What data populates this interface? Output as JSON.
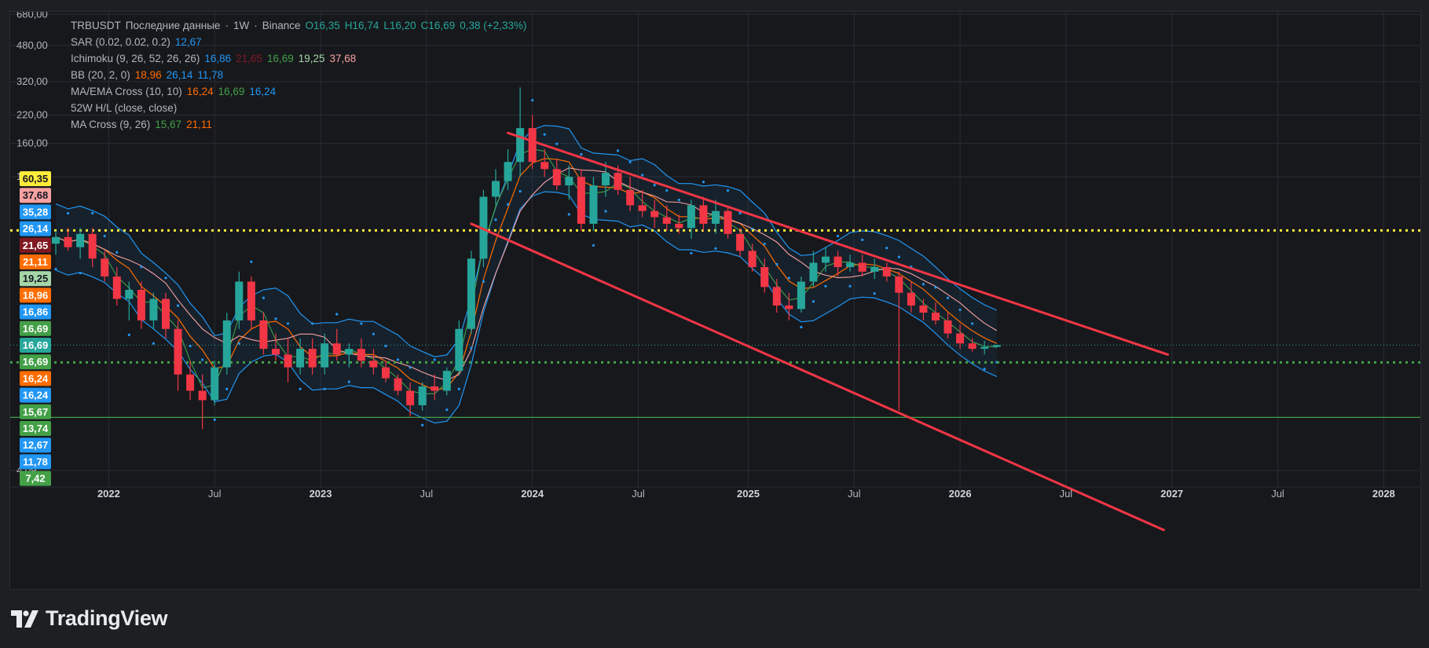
{
  "legend": {
    "symbol": "TRBUSDT",
    "data_label": "Последние данные",
    "interval": "1W",
    "exchange": "Binance",
    "ohlc": {
      "o": "O16,35",
      "h": "H16,74",
      "l": "L16,20",
      "c": "C16,69",
      "change": "0,38 (+2,33%)"
    },
    "indicators": [
      {
        "name": "SAR (0.02, 0.02, 0.2)",
        "values": [
          {
            "v": "12,67",
            "color": "#2196f3"
          }
        ]
      },
      {
        "name": "Ichimoku (9, 26, 52, 26, 26)",
        "values": [
          {
            "v": "16,86",
            "color": "#2196f3"
          },
          {
            "v": "21,65",
            "color": "#801922"
          },
          {
            "v": "16,69",
            "color": "#43a047"
          },
          {
            "v": "19,25",
            "color": "#a5d6a7"
          },
          {
            "v": "37,68",
            "color": "#f7a1a1"
          }
        ]
      },
      {
        "name": "BB (20, 2, 0)",
        "values": [
          {
            "v": "18,96",
            "color": "#ff6d00"
          },
          {
            "v": "26,14",
            "color": "#2196f3"
          },
          {
            "v": "11,78",
            "color": "#2196f3"
          }
        ]
      },
      {
        "name": "MA/EMA Cross (10, 10)",
        "values": [
          {
            "v": "16,24",
            "color": "#ff6d00"
          },
          {
            "v": "16,69",
            "color": "#43a047"
          },
          {
            "v": "16,24",
            "color": "#2196f3"
          }
        ]
      },
      {
        "name": "52W H/L (close, close)",
        "values": []
      },
      {
        "name": "MA Cross (9, 26)",
        "values": [
          {
            "v": "15,67",
            "color": "#43a047"
          },
          {
            "v": "21,11",
            "color": "#ff6d00"
          }
        ]
      }
    ]
  },
  "watermark": {
    "text": "TradingView"
  },
  "chart_data": {
    "type": "candlestick",
    "y_scale": "log",
    "y_ticks": [
      "680,00",
      "480,00",
      "320,00",
      "220,00",
      "160,00",
      "110,00",
      "4,09"
    ],
    "y_tick_values": [
      680,
      480,
      320,
      220,
      160,
      110,
      4.09
    ],
    "x_ticks": [
      {
        "label": "2022",
        "date": "2022-01-03"
      },
      {
        "label": "Jul",
        "date": "2022-07-04"
      },
      {
        "label": "2023",
        "date": "2023-01-02"
      },
      {
        "label": "Jul",
        "date": "2023-07-03"
      },
      {
        "label": "2024",
        "date": "2024-01-01"
      },
      {
        "label": "Jul",
        "date": "2024-07-01"
      },
      {
        "label": "2025",
        "date": "2025-01-06"
      },
      {
        "label": "Jul",
        "date": "2025-07-07"
      },
      {
        "label": "2026",
        "date": "2026-01-05"
      },
      {
        "label": "Jul",
        "date": "2026-07-06"
      },
      {
        "label": "2027",
        "date": "2027-01-04"
      },
      {
        "label": "Jul",
        "date": "2027-07-05"
      },
      {
        "label": "2028",
        "date": "2028-01-03"
      }
    ],
    "x_range": [
      "2021-10-04",
      "2028-03-06"
    ],
    "y_range": [
      3.4,
      700
    ],
    "price_labels": [
      {
        "v": "60,35",
        "bg": "#ffeb3b",
        "fg": "#131722"
      },
      {
        "v": "37,68",
        "bg": "#f7a1a1",
        "fg": "#131722"
      },
      {
        "v": "35,28",
        "bg": "#2196f3",
        "fg": "#ffffff"
      },
      {
        "v": "26,14",
        "bg": "#2196f3",
        "fg": "#ffffff"
      },
      {
        "v": "21,65",
        "bg": "#801922",
        "fg": "#ffffff"
      },
      {
        "v": "21,11",
        "bg": "#ff6d00",
        "fg": "#ffffff"
      },
      {
        "v": "19,25",
        "bg": "#a5d6a7",
        "fg": "#131722"
      },
      {
        "v": "18,96",
        "bg": "#ff6d00",
        "fg": "#ffffff"
      },
      {
        "v": "16,86",
        "bg": "#2196f3",
        "fg": "#ffffff"
      },
      {
        "v": "16,69",
        "bg": "#43a047",
        "fg": "#ffffff"
      },
      {
        "v": "16,69",
        "bg": "#26a69a",
        "fg": "#ffffff"
      },
      {
        "v": "16,69",
        "bg": "#43a047",
        "fg": "#ffffff"
      },
      {
        "v": "16,24",
        "bg": "#ff6d00",
        "fg": "#ffffff"
      },
      {
        "v": "16,24",
        "bg": "#2196f3",
        "fg": "#ffffff"
      },
      {
        "v": "15,67",
        "bg": "#43a047",
        "fg": "#ffffff"
      },
      {
        "v": "13,74",
        "bg": "#43a047",
        "fg": "#ffffff"
      },
      {
        "v": "12,67",
        "bg": "#2196f3",
        "fg": "#ffffff"
      },
      {
        "v": "11,78",
        "bg": "#2196f3",
        "fg": "#ffffff"
      },
      {
        "v": "7,42",
        "bg": "#43a047",
        "fg": "#ffffff"
      }
    ],
    "horizontal_levels": [
      {
        "value": 60.35,
        "style": "dotted",
        "color": "#ffeb3b"
      },
      {
        "value": 13.74,
        "style": "dotted",
        "color": "#43a047"
      },
      {
        "value": 7.42,
        "style": "solid",
        "color": "#43a047"
      },
      {
        "value": 16.69,
        "style": "dotted",
        "color": "#26a69a"
      }
    ],
    "trend_lines": [
      {
        "from": [
          "2023-11-20",
          180
        ],
        "to": [
          "2026-12-28",
          15
        ],
        "color": "#f23645"
      },
      {
        "from": [
          "2023-09-18",
          65
        ],
        "to": [
          "2026-12-21",
          2.1
        ],
        "color": "#f23645"
      }
    ],
    "candles": [
      {
        "date": "2021-10-04",
        "o": 52,
        "h": 60,
        "l": 46,
        "c": 56
      },
      {
        "date": "2021-10-25",
        "o": 56,
        "h": 62,
        "l": 48,
        "c": 50
      },
      {
        "date": "2021-11-15",
        "o": 50,
        "h": 62,
        "l": 44,
        "c": 58
      },
      {
        "date": "2021-12-06",
        "o": 58,
        "h": 62,
        "l": 40,
        "c": 44
      },
      {
        "date": "2021-12-27",
        "o": 44,
        "h": 48,
        "l": 34,
        "c": 36
      },
      {
        "date": "2022-01-17",
        "o": 36,
        "h": 40,
        "l": 26,
        "c": 28
      },
      {
        "date": "2022-02-07",
        "o": 28,
        "h": 34,
        "l": 22,
        "c": 31
      },
      {
        "date": "2022-02-28",
        "o": 31,
        "h": 34,
        "l": 20,
        "c": 22
      },
      {
        "date": "2022-03-21",
        "o": 22,
        "h": 30,
        "l": 20,
        "c": 28
      },
      {
        "date": "2022-04-11",
        "o": 28,
        "h": 30,
        "l": 18,
        "c": 20
      },
      {
        "date": "2022-05-02",
        "o": 20,
        "h": 22,
        "l": 10,
        "c": 12
      },
      {
        "date": "2022-05-23",
        "o": 12,
        "h": 14,
        "l": 9,
        "c": 10
      },
      {
        "date": "2022-06-13",
        "o": 10,
        "h": 12,
        "l": 6.5,
        "c": 9
      },
      {
        "date": "2022-07-04",
        "o": 9,
        "h": 14,
        "l": 8.5,
        "c": 13
      },
      {
        "date": "2022-07-25",
        "o": 13,
        "h": 24,
        "l": 12,
        "c": 22
      },
      {
        "date": "2022-08-15",
        "o": 22,
        "h": 38,
        "l": 20,
        "c": 34
      },
      {
        "date": "2022-09-05",
        "o": 34,
        "h": 36,
        "l": 20,
        "c": 22
      },
      {
        "date": "2022-09-26",
        "o": 22,
        "h": 24,
        "l": 15,
        "c": 16
      },
      {
        "date": "2022-10-17",
        "o": 16,
        "h": 19,
        "l": 14,
        "c": 15
      },
      {
        "date": "2022-11-07",
        "o": 15,
        "h": 18,
        "l": 11,
        "c": 13
      },
      {
        "date": "2022-11-28",
        "o": 13,
        "h": 18,
        "l": 12,
        "c": 16
      },
      {
        "date": "2022-12-19",
        "o": 16,
        "h": 18,
        "l": 12,
        "c": 13
      },
      {
        "date": "2023-01-09",
        "o": 13,
        "h": 19,
        "l": 12,
        "c": 17
      },
      {
        "date": "2023-01-30",
        "o": 17,
        "h": 20,
        "l": 14,
        "c": 15
      },
      {
        "date": "2023-02-20",
        "o": 15,
        "h": 17,
        "l": 13,
        "c": 16
      },
      {
        "date": "2023-03-13",
        "o": 16,
        "h": 18,
        "l": 13,
        "c": 14
      },
      {
        "date": "2023-04-03",
        "o": 14,
        "h": 16,
        "l": 12,
        "c": 13
      },
      {
        "date": "2023-04-24",
        "o": 13,
        "h": 14,
        "l": 11,
        "c": 11.5
      },
      {
        "date": "2023-05-15",
        "o": 11.5,
        "h": 12,
        "l": 9.5,
        "c": 10
      },
      {
        "date": "2023-06-05",
        "o": 10,
        "h": 11,
        "l": 7.5,
        "c": 8.5
      },
      {
        "date": "2023-06-26",
        "o": 8.5,
        "h": 11,
        "l": 8,
        "c": 10.5
      },
      {
        "date": "2023-07-17",
        "o": 10.5,
        "h": 12,
        "l": 9,
        "c": 10
      },
      {
        "date": "2023-08-07",
        "o": 10,
        "h": 13,
        "l": 9.5,
        "c": 12.5
      },
      {
        "date": "2023-08-28",
        "o": 12.5,
        "h": 22,
        "l": 12,
        "c": 20
      },
      {
        "date": "2023-09-18",
        "o": 20,
        "h": 48,
        "l": 19,
        "c": 44
      },
      {
        "date": "2023-10-09",
        "o": 44,
        "h": 95,
        "l": 40,
        "c": 88
      },
      {
        "date": "2023-10-30",
        "o": 88,
        "h": 120,
        "l": 80,
        "c": 105
      },
      {
        "date": "2023-11-20",
        "o": 105,
        "h": 150,
        "l": 95,
        "c": 130
      },
      {
        "date": "2023-12-11",
        "o": 130,
        "h": 300,
        "l": 110,
        "c": 190
      },
      {
        "date": "2024-01-01",
        "o": 190,
        "h": 220,
        "l": 120,
        "c": 130
      },
      {
        "date": "2024-01-22",
        "o": 130,
        "h": 150,
        "l": 110,
        "c": 120
      },
      {
        "date": "2024-02-12",
        "o": 120,
        "h": 135,
        "l": 95,
        "c": 100
      },
      {
        "date": "2024-03-04",
        "o": 100,
        "h": 125,
        "l": 85,
        "c": 110
      },
      {
        "date": "2024-03-25",
        "o": 110,
        "h": 120,
        "l": 60,
        "c": 65
      },
      {
        "date": "2024-04-15",
        "o": 65,
        "h": 110,
        "l": 60,
        "c": 100
      },
      {
        "date": "2024-05-06",
        "o": 100,
        "h": 130,
        "l": 88,
        "c": 115
      },
      {
        "date": "2024-05-27",
        "o": 115,
        "h": 125,
        "l": 90,
        "c": 95
      },
      {
        "date": "2024-06-17",
        "o": 95,
        "h": 110,
        "l": 75,
        "c": 80
      },
      {
        "date": "2024-07-08",
        "o": 80,
        "h": 95,
        "l": 70,
        "c": 75
      },
      {
        "date": "2024-07-29",
        "o": 75,
        "h": 85,
        "l": 62,
        "c": 70
      },
      {
        "date": "2024-08-19",
        "o": 70,
        "h": 80,
        "l": 60,
        "c": 65
      },
      {
        "date": "2024-09-09",
        "o": 65,
        "h": 72,
        "l": 58,
        "c": 62
      },
      {
        "date": "2024-09-30",
        "o": 62,
        "h": 85,
        "l": 55,
        "c": 80
      },
      {
        "date": "2024-10-21",
        "o": 80,
        "h": 88,
        "l": 60,
        "c": 65
      },
      {
        "date": "2024-11-11",
        "o": 65,
        "h": 85,
        "l": 58,
        "c": 75
      },
      {
        "date": "2024-12-02",
        "o": 75,
        "h": 80,
        "l": 55,
        "c": 58
      },
      {
        "date": "2024-12-23",
        "o": 58,
        "h": 62,
        "l": 45,
        "c": 48
      },
      {
        "date": "2025-01-13",
        "o": 48,
        "h": 52,
        "l": 38,
        "c": 40
      },
      {
        "date": "2025-02-03",
        "o": 40,
        "h": 44,
        "l": 30,
        "c": 32
      },
      {
        "date": "2025-02-24",
        "o": 32,
        "h": 35,
        "l": 24,
        "c": 26
      },
      {
        "date": "2025-03-17",
        "o": 26,
        "h": 30,
        "l": 22,
        "c": 25
      },
      {
        "date": "2025-04-07",
        "o": 25,
        "h": 36,
        "l": 24,
        "c": 34
      },
      {
        "date": "2025-04-28",
        "o": 34,
        "h": 48,
        "l": 32,
        "c": 42
      },
      {
        "date": "2025-05-19",
        "o": 42,
        "h": 50,
        "l": 38,
        "c": 45
      },
      {
        "date": "2025-06-09",
        "o": 45,
        "h": 48,
        "l": 36,
        "c": 40
      },
      {
        "date": "2025-06-30",
        "o": 40,
        "h": 46,
        "l": 38,
        "c": 42
      },
      {
        "date": "2025-07-21",
        "o": 42,
        "h": 46,
        "l": 36,
        "c": 38
      },
      {
        "date": "2025-08-11",
        "o": 38,
        "h": 44,
        "l": 35,
        "c": 40
      },
      {
        "date": "2025-09-01",
        "o": 40,
        "h": 42,
        "l": 34,
        "c": 36
      },
      {
        "date": "2025-09-22",
        "o": 36,
        "h": 38,
        "l": 8,
        "c": 30
      },
      {
        "date": "2025-10-13",
        "o": 30,
        "h": 34,
        "l": 24,
        "c": 26
      },
      {
        "date": "2025-11-03",
        "o": 26,
        "h": 28,
        "l": 22,
        "c": 24
      },
      {
        "date": "2025-11-24",
        "o": 24,
        "h": 27,
        "l": 21,
        "c": 22
      },
      {
        "date": "2025-12-15",
        "o": 22,
        "h": 24,
        "l": 18,
        "c": 19
      },
      {
        "date": "2026-01-05",
        "o": 19,
        "h": 21,
        "l": 16,
        "c": 17
      },
      {
        "date": "2026-01-26",
        "o": 17,
        "h": 18,
        "l": 15.5,
        "c": 16
      },
      {
        "date": "2026-02-16",
        "o": 16,
        "h": 17.5,
        "l": 15,
        "c": 16.35
      },
      {
        "date": "2026-03-09",
        "o": 16.35,
        "h": 16.74,
        "l": 16.2,
        "c": 16.69
      }
    ]
  }
}
